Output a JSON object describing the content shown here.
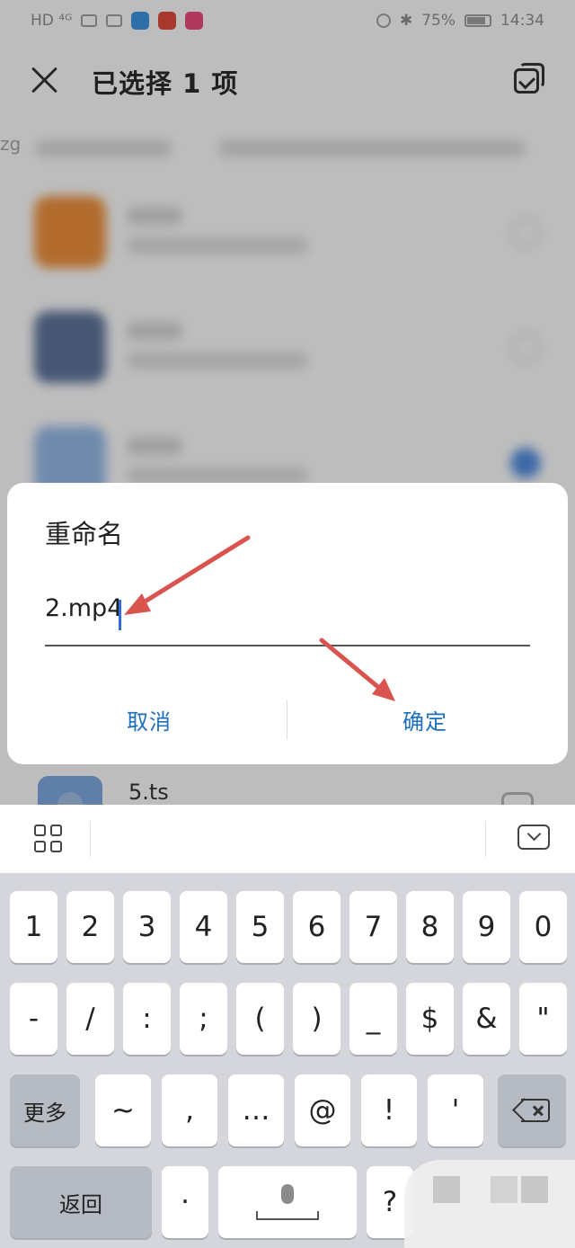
{
  "status_bar": {
    "left": "HD ⁴ᴳ",
    "battery": "75%",
    "time": "14:34"
  },
  "top_bar": {
    "title": "已选择 1 项"
  },
  "background": {
    "path_prefix": "zg",
    "visible_file": "5.ts"
  },
  "dialog": {
    "title": "重命名",
    "input_value": "2.mp4",
    "cancel_label": "取消",
    "ok_label": "确定"
  },
  "keyboard": {
    "row1": [
      "1",
      "2",
      "3",
      "4",
      "5",
      "6",
      "7",
      "8",
      "9",
      "0"
    ],
    "row2": [
      "-",
      "/",
      ":",
      ";",
      "(",
      ")",
      "_",
      "$",
      "&",
      "\""
    ],
    "row3_left": "更多",
    "row3": [
      "~",
      ",",
      "…",
      "@",
      "!",
      "'"
    ],
    "row4_left": "返回",
    "row4_dot": "·",
    "row4_q": "?"
  },
  "colors": {
    "accent": "#1e6fbd",
    "annotation_arrow": "#d9534f"
  }
}
